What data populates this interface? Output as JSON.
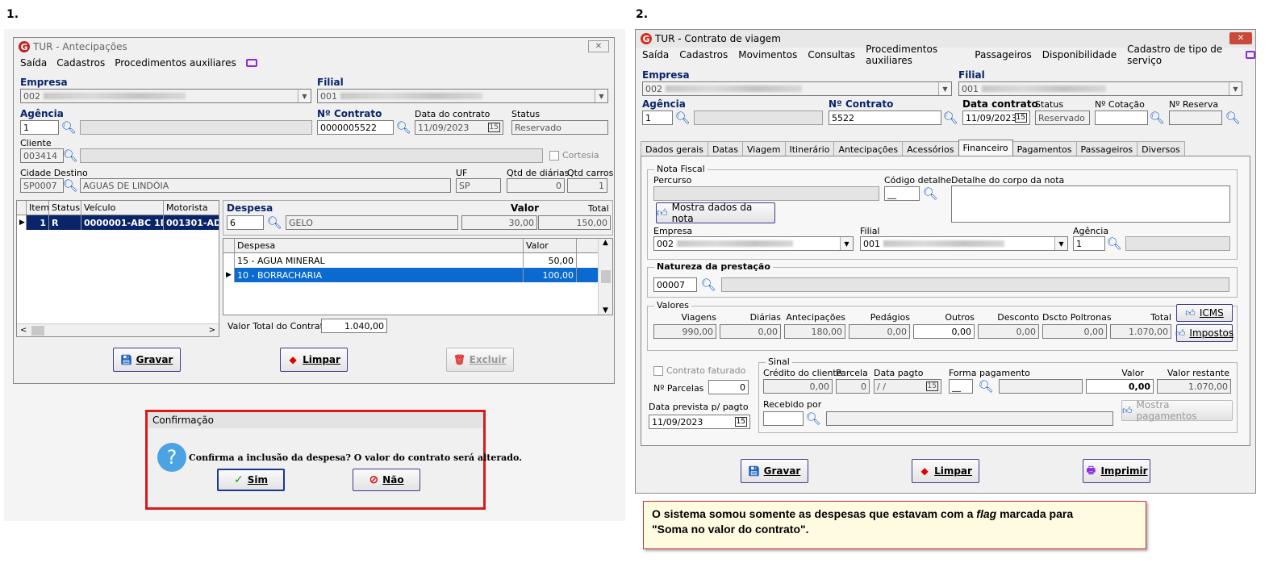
{
  "steps": {
    "one": "1.",
    "two": "2."
  },
  "w1": {
    "title": "TUR - Antecipações",
    "menu": [
      "Saída",
      "Cadastros",
      "Procedimentos auxiliares"
    ],
    "empresa_label": "Empresa",
    "empresa_value": "002",
    "filial_label": "Filial",
    "filial_value": "001",
    "agencia_label": "Agência",
    "agencia_value": "1",
    "contrato_label": "Nº Contrato",
    "contrato_value": "0000005522",
    "data_contrato_label": "Data do contrato",
    "data_contrato_value": "11/09/2023",
    "status_label": "Status",
    "status_value": "Reservado",
    "cliente_label": "Cliente",
    "cliente_value": "003414",
    "cortesia_label": "Cortesia",
    "cidade_label": "Cidade Destino",
    "cidade_code": "SP0007",
    "cidade_name": "AGUAS DE LINDÓIA",
    "uf_label": "UF",
    "uf_value": "SP",
    "qtd_diarias_label": "Qtd de diárias",
    "qtd_diarias_value": "0",
    "qtd_carros_label": "Qtd carros",
    "qtd_carros_value": "1",
    "vehicle_grid": {
      "headers": [
        "Item",
        "Status",
        "Veículo",
        "Motorista"
      ],
      "rows": [
        [
          "1",
          "R",
          "0000001-ABC 1D",
          "001301-AD"
        ]
      ]
    },
    "despesa_label": "Despesa",
    "valor_label": "Valor",
    "total_label": "Total",
    "despesa_code": "6",
    "despesa_name": "GELO",
    "despesa_valor": "30,00",
    "despesa_total": "150,00",
    "despesa_grid": {
      "headers": [
        "Despesa",
        "Valor"
      ],
      "rows": [
        [
          "15 - AGUA MINERAL",
          "50,00"
        ],
        [
          "10 - BORRACHARIA",
          "100,00"
        ]
      ]
    },
    "valor_total_label": "Valor Total do Contrato:",
    "valor_total_value": "1.040,00",
    "btn_gravar": "Gravar",
    "btn_limpar": "Limpar",
    "btn_excluir": "Excluir"
  },
  "dialog": {
    "title": "Confirmação",
    "message": "Confirma a inclusão da despesa? O valor do contrato será alterado.",
    "btn_sim": "Sim",
    "btn_nao": "Não"
  },
  "w2": {
    "title": "TUR - Contrato de viagem",
    "menu": [
      "Saída",
      "Cadastros",
      "Movimentos",
      "Consultas",
      "Procedimentos auxiliares",
      "Passageiros",
      "Disponibilidade",
      "Cadastro de tipo de serviço"
    ],
    "empresa_label": "Empresa",
    "empresa_value": "002",
    "filial_label": "Filial",
    "filial_value": "001",
    "agencia_label": "Agência",
    "agencia_value": "1",
    "contrato_label": "Nº Contrato",
    "contrato_value": "5522",
    "data_contrato_label": "Data contrato",
    "data_contrato_value": "11/09/2023",
    "status_label": "Status",
    "status_value": "Reservado",
    "cotacao_label": "Nº Cotação",
    "reserva_label": "Nº Reserva",
    "tabs": [
      "Dados gerais",
      "Datas",
      "Viagem",
      "Itinerário",
      "Antecipações",
      "Acessórios",
      "Financeiro",
      "Pagamentos",
      "Passageiros",
      "Diversos"
    ],
    "nota_fiscal_label": "Nota Fiscal",
    "percurso_label": "Percurso",
    "codigo_detalhe_label": "Código detalhe",
    "codigo_detalhe_value": "__",
    "detalhe_corpo_label": "Detalhe do corpo da nota",
    "btn_mostra_nota": "Mostra dados da nota",
    "nf_empresa_label": "Empresa",
    "nf_empresa_value": "002",
    "nf_filial_label": "Filial",
    "nf_filial_value": "001",
    "nf_agencia_label": "Agência",
    "nf_agencia_value": "1",
    "natureza_label": "Natureza da prestação",
    "natureza_value": "00007",
    "valores_label": "Valores",
    "valores_headers": [
      "Viagens",
      "Diárias",
      "Antecipações",
      "Pedágios",
      "Outros",
      "Desconto",
      "Dscto Poltronas",
      "Total"
    ],
    "valores_values": [
      "990,00",
      "0,00",
      "180,00",
      "0,00",
      "0,00",
      "0,00",
      "0,00",
      "1.070,00"
    ],
    "btn_icms": "ICMS",
    "btn_impostos": "Impostos",
    "contrato_faturado_label": "Contrato faturado",
    "nparcelas_label": "Nº Parcelas",
    "nparcelas_value": "0",
    "data_prevista_label": "Data prevista p/ pagto",
    "data_prevista_value": "11/09/2023",
    "sinal_label": "Sinal",
    "credito_label": "Crédito do cliente",
    "credito_value": "0,00",
    "parcela_label": "Parcela",
    "parcela_value": "0",
    "data_pagto_label": "Data pagto",
    "data_pagto_value": "/ /",
    "forma_pagto_label": "Forma pagamento",
    "forma_pagto_value": "__",
    "valor_label": "Valor",
    "valor_value": "0,00",
    "valor_restante_label": "Valor restante",
    "valor_restante_value": "1.070,00",
    "recebido_label": "Recebido por",
    "btn_mostra_pag": "Mostra pagamentos",
    "btn_gravar": "Gravar",
    "btn_limpar": "Limpar",
    "btn_imprimir": "Imprimir"
  },
  "note": {
    "line1_a": "O sistema somou somente as despesas que estavam com a ",
    "line1_b": "flag",
    "line1_c": " marcada para",
    "line2": "\"Soma no valor do contrato\"."
  }
}
